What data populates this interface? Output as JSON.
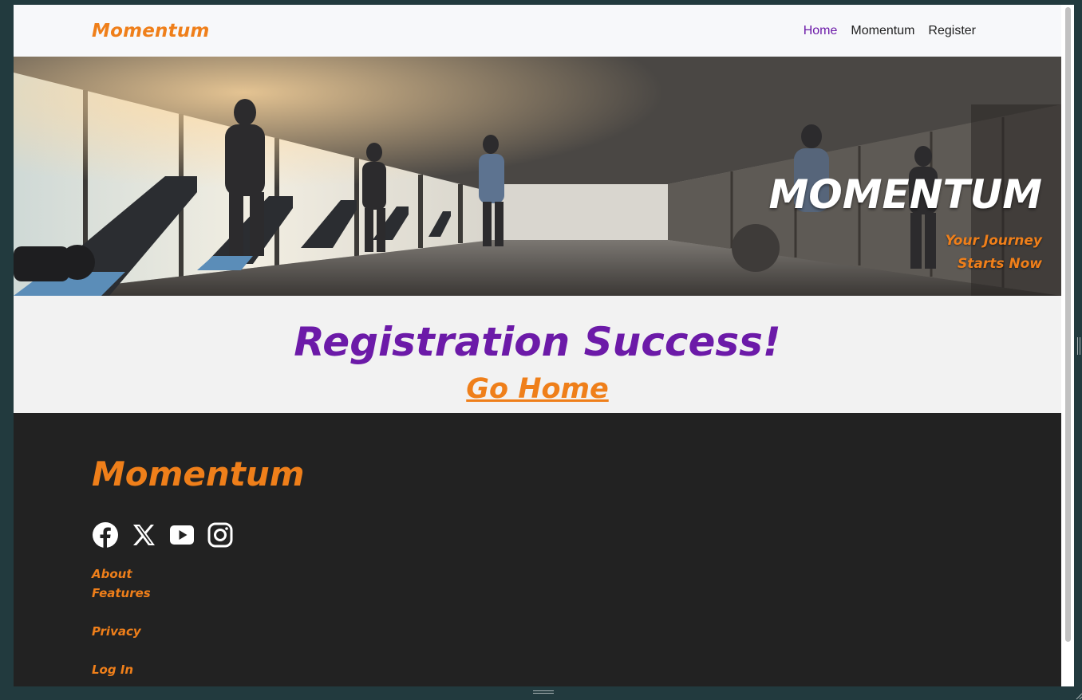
{
  "navbar": {
    "brand": "Momentum",
    "links": [
      {
        "label": "Home",
        "active": true
      },
      {
        "label": "Momentum",
        "active": false
      },
      {
        "label": "Register",
        "active": false
      }
    ]
  },
  "hero": {
    "title": "MOMENTUM",
    "subtitle_line1": "Your Journey",
    "subtitle_line2": "Starts Now",
    "image_description": "gym interior with treadmills"
  },
  "main": {
    "heading": "Registration Success!",
    "link_label": "Go Home"
  },
  "footer": {
    "brand": "Momentum",
    "socials": [
      "facebook-icon",
      "x-icon",
      "youtube-icon",
      "instagram-icon"
    ],
    "links": [
      "About",
      "Features",
      "Privacy",
      "Log In"
    ]
  },
  "colors": {
    "accent_orange": "#ef7f1a",
    "brand_purple": "#6c1aa8",
    "footer_bg": "#222222"
  }
}
